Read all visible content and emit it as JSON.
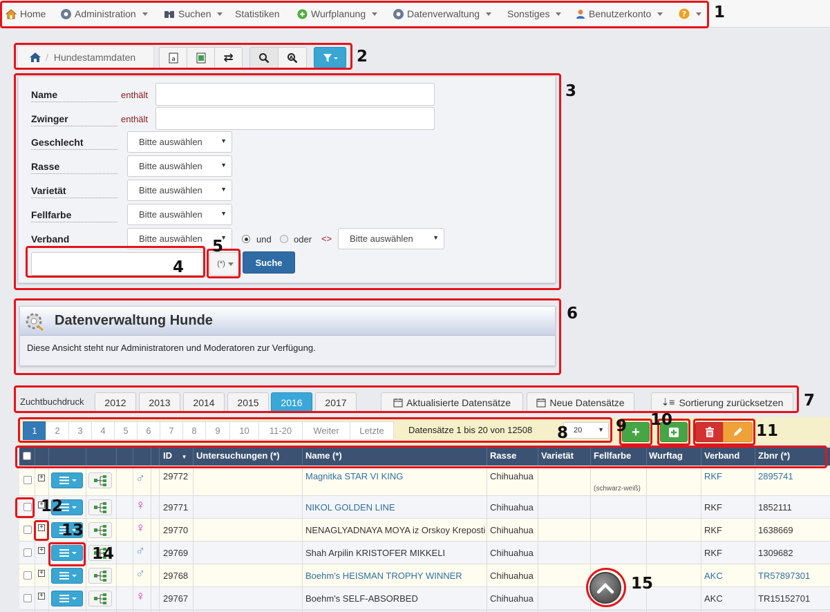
{
  "nav": {
    "items": [
      {
        "label": "Home",
        "icon": "home-icon",
        "caret": false
      },
      {
        "label": "Administration",
        "icon": "gear-icon",
        "caret": true
      },
      {
        "label": "Suchen",
        "icon": "binoculars-icon",
        "caret": true
      },
      {
        "label": "Statistiken",
        "icon": "",
        "caret": false
      },
      {
        "label": "Wurfplanung",
        "icon": "plus-circle-icon",
        "caret": true
      },
      {
        "label": "Datenverwaltung",
        "icon": "gear-icon",
        "caret": true
      },
      {
        "label": "Sonstiges",
        "icon": "",
        "caret": true
      },
      {
        "label": "Benutzerkonto",
        "icon": "user-icon",
        "caret": true
      },
      {
        "label": "",
        "icon": "help-icon",
        "caret": true
      }
    ]
  },
  "breadcrumb": {
    "sep": "/",
    "label": "Hundestammdaten"
  },
  "search": {
    "fields": [
      {
        "label": "Name",
        "op": "enthält",
        "type": "text",
        "value": ""
      },
      {
        "label": "Zwinger",
        "op": "enthält",
        "type": "text",
        "value": ""
      },
      {
        "label": "Geschlecht",
        "type": "select",
        "value": "Bitte auswählen"
      },
      {
        "label": "Rasse",
        "type": "select",
        "value": "Bitte auswählen"
      },
      {
        "label": "Varietät",
        "type": "select",
        "value": "Bitte auswählen"
      },
      {
        "label": "Fellfarbe",
        "type": "select",
        "value": "Bitte auswählen"
      },
      {
        "label": "Verband",
        "type": "select",
        "value": "Bitte auswählen"
      }
    ],
    "and_label": "und",
    "or_label": "oder",
    "neq_label": "<>",
    "second_select": "Bitte auswählen",
    "wildcard": "(*)",
    "submit": "Suche"
  },
  "info": {
    "title": "Datenverwaltung Hunde",
    "text": "Diese Ansicht steht nur Administratoren und Moderatoren zur Verfügung."
  },
  "zuchtbuch": {
    "label": "Zuchtbuchdruck",
    "years": [
      "2012",
      "2013",
      "2014",
      "2015",
      "2016",
      "2017"
    ],
    "active_year": "2016",
    "updated": "Aktualisierte Datensätze",
    "new": "Neue Datensätze",
    "reset": "Sortierung zurücksetzen"
  },
  "pagination": {
    "pages": [
      "1",
      "2",
      "3",
      "4",
      "5",
      "6",
      "7",
      "8",
      "9",
      "10",
      "11-20",
      "Weiter",
      "Letzte"
    ],
    "active": "1",
    "info": "Datensätze 1 bis 20 von 12508",
    "per_page": "20"
  },
  "table": {
    "columns": [
      "ID",
      "Untersuchungen (*)",
      "Name (*)",
      "Rasse",
      "Varietät",
      "Fellfarbe",
      "Wurftag",
      "Verband",
      "Zbnr (*)"
    ],
    "rows": [
      {
        "sex": "♂",
        "sex_color": "#6a9fbf",
        "id": "29772",
        "name": "Magnitka STAR VI KING",
        "name_link": true,
        "rasse": "Chihuahua",
        "fellfarbe": "(schwarz-weiß)",
        "verband": "RKF",
        "verband_link": true,
        "zbnr": "2895741",
        "zbnr_link": true
      },
      {
        "sex": "♀",
        "sex_color": "#e02fcf",
        "id": "29771",
        "name": "NIKOL GOLDEN LINE",
        "name_link": true,
        "rasse": "Chihuahua",
        "fellfarbe": "",
        "verband": "RKF",
        "verband_link": false,
        "zbnr": "1852111",
        "zbnr_link": false
      },
      {
        "sex": "♀",
        "sex_color": "#e02fcf",
        "id": "29770",
        "name": "NENAGLYADNAYA MOYA iz Orskoy Kreposti",
        "name_link": false,
        "rasse": "Chihuahua",
        "fellfarbe": "",
        "verband": "RKF",
        "verband_link": false,
        "zbnr": "1638669",
        "zbnr_link": false
      },
      {
        "sex": "♂",
        "sex_color": "#6a9fbf",
        "id": "29769",
        "name": "Shah Arpilin KRISTOFER MIKKELI",
        "name_link": false,
        "rasse": "Chihuahua",
        "fellfarbe": "",
        "verband": "RKF",
        "verband_link": false,
        "zbnr": "1309682",
        "zbnr_link": false
      },
      {
        "sex": "♂",
        "sex_color": "#6a9fbf",
        "id": "29768",
        "name": "Boehm's HEISMAN TROPHY WINNER",
        "name_link": true,
        "rasse": "Chihuahua",
        "fellfarbe": "",
        "verband": "AKC",
        "verband_link": true,
        "zbnr": "TR57897301",
        "zbnr_link": true
      },
      {
        "sex": "♀",
        "sex_color": "#e02fcf",
        "id": "29767",
        "name": "Boehm's SELF-ABSORBED",
        "name_link": false,
        "rasse": "Chihuahua",
        "fellfarbe": "",
        "verband": "AKC",
        "verband_link": false,
        "zbnr": "TR15152701",
        "zbnr_link": false
      }
    ]
  },
  "annotations": [
    "1",
    "2",
    "3",
    "4",
    "5",
    "6",
    "7",
    "8",
    "9",
    "10",
    "11",
    "12",
    "13",
    "14",
    "15"
  ],
  "colors": {
    "accent_blue": "#39a6d3",
    "header": "#3c5272",
    "link": "#2f6fa0",
    "annotation": "#e3141a"
  }
}
